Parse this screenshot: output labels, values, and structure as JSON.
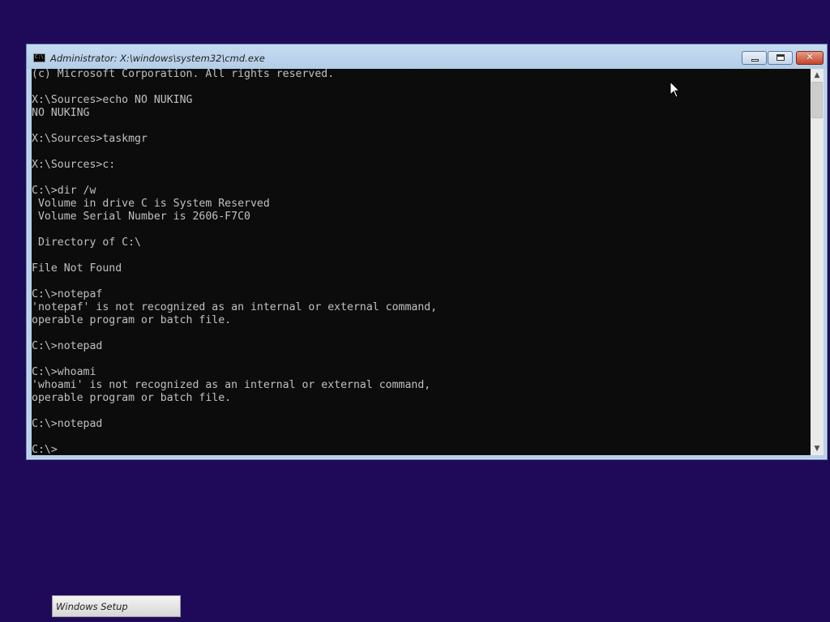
{
  "window": {
    "title": "Administrator: X:\\windows\\system32\\cmd.exe",
    "icon_label": "C:\\",
    "minimize_icon": "minimize-icon",
    "maximize_icon": "maximize-icon",
    "close_glyph": "✕"
  },
  "console": {
    "lines": [
      "(c) Microsoft Corporation. All rights reserved.",
      "",
      "X:\\Sources>echo NO NUKING",
      "NO NUKING",
      "",
      "X:\\Sources>taskmgr",
      "",
      "X:\\Sources>c:",
      "",
      "C:\\>dir /w",
      " Volume in drive C is System Reserved",
      " Volume Serial Number is 2606-F7C0",
      "",
      " Directory of C:\\",
      "",
      "File Not Found",
      "",
      "C:\\>notepaf",
      "'notepaf' is not recognized as an internal or external command,",
      "operable program or batch file.",
      "",
      "C:\\>notepad",
      "",
      "C:\\>whoami",
      "'whoami' is not recognized as an internal or external command,",
      "operable program or batch file.",
      "",
      "C:\\>notepad",
      "",
      "C:\\>"
    ]
  },
  "scrollbar": {
    "up_arrow": "▲",
    "down_arrow": "▼"
  },
  "taskbar": {
    "setup_label": "Windows Setup"
  },
  "colors": {
    "desktop": "#1f0a5a",
    "console_bg": "#0c0c0c",
    "console_fg": "#c0c0c0",
    "close_button": "#c3452b"
  }
}
